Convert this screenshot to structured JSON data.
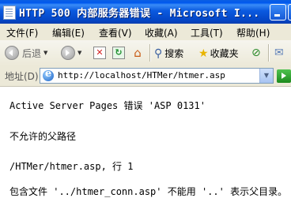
{
  "window": {
    "title": "HTTP 500 内部服务器错误 - Microsoft I..."
  },
  "menu": {
    "items": [
      "文件(F)",
      "编辑(E)",
      "查看(V)",
      "收藏(A)",
      "工具(T)",
      "帮助(H)"
    ]
  },
  "toolbar": {
    "back_label": "后退",
    "back_icon": "back-arrow-icon",
    "forward_icon": "forward-arrow-icon",
    "stop_icon": "stop-icon",
    "refresh_icon": "refresh-icon",
    "home_icon": "home-icon",
    "search_label": "搜索",
    "search_icon": "search-icon",
    "favorites_label": "收藏夹",
    "favorites_icon": "star-icon",
    "media_icon": "media-icon",
    "mail_icon": "mail-icon"
  },
  "address": {
    "label": "地址(D)",
    "url": "http://localhost/HTMer/htmer.asp"
  },
  "page": {
    "error_title": "Active Server Pages 错误 'ASP 0131'",
    "error_message": "不允许的父路径",
    "location": "/HTMer/htmer.asp, 行 1",
    "detail": "包含文件 '../htmer_conn.asp' 不能用 '..' 表示父目录。"
  },
  "colors": {
    "titlebar": "#0a5ae0",
    "chrome": "#ece9d8",
    "address_border": "#7f9db9"
  }
}
